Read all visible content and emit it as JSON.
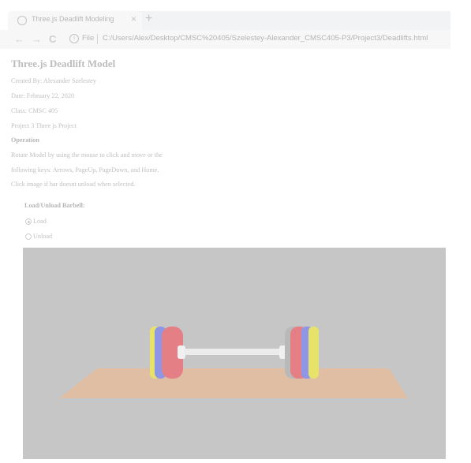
{
  "browser": {
    "tab_title": "Three.js Deadlift Modeling",
    "close_glyph": "×",
    "new_tab_glyph": "+",
    "back_glyph": "←",
    "forward_glyph": "→",
    "reload_glyph": "C",
    "info_glyph": "i",
    "url_scheme_label": "File",
    "url": "C:/Users/Alex/Desktop/CMSC%20405/Szelestey-Alexander_CMSC405-P3/Project3/Deadlifts.html"
  },
  "page": {
    "title": "Three.js Deadlift Model",
    "created_by": "Created By: Alexander Szelestey",
    "date": "Date: February 22, 2020",
    "class": "Class: CMSC 405",
    "project": "Project 3 Three js Project",
    "operation_heading": "Operation",
    "operation_line1": "Rotate Model by using the mouse to click and move or the",
    "operation_line2": "following keys: Arrows, PageUp, PageDown, and Home.",
    "operation_line3": "Click image if bar doesnt unload when selected.",
    "barbell_group_label": "Load/Unload Barbell:",
    "options": [
      {
        "label": "Load",
        "checked": true
      },
      {
        "label": "Unload",
        "checked": false
      }
    ]
  },
  "scene": {
    "background_color": "#c6c6c6",
    "platform_color": "#dfbea4",
    "bar_color": "#e6e6e6",
    "plate_colors": [
      "#e7e26a",
      "#8f96e6",
      "#e57f86",
      "#b9b9b9"
    ]
  }
}
